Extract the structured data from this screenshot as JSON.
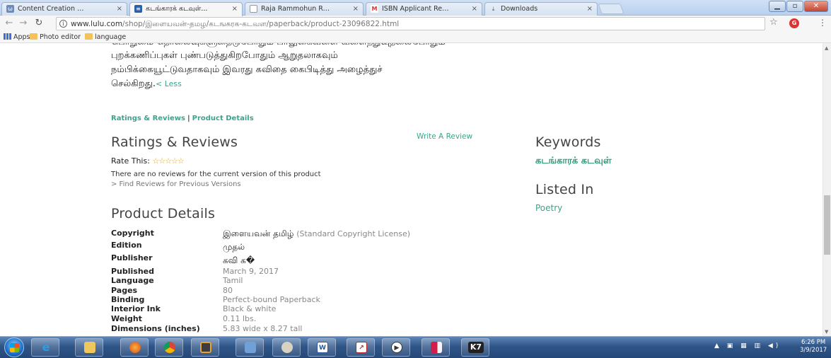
{
  "browser": {
    "tabs": [
      {
        "title": "Content Creation Wizard",
        "active": false
      },
      {
        "title": "கடங்காரக் கடவுள்...",
        "active": true
      },
      {
        "title": "Raja Rammohun Roy Na",
        "active": false
      },
      {
        "title": "ISBN Applicant Registrat",
        "active": false
      },
      {
        "title": "Downloads",
        "active": false
      }
    ],
    "close_glyph": "×",
    "url_host": "www.lulu.com",
    "url_path": "/shop/இளையவன்-தமழ/கடஙகரக-கடவள/paperback/product-23096822.html",
    "bookmarks": [
      "Apps",
      "Photo editor",
      "language"
    ]
  },
  "page": {
    "description_cut": "பொறுமை தொலைவுகளுதைடுபோதும் பாலுகைவளை வளைந்துவுதலைபோதும்",
    "description_lines": [
      "புறக்கணிப்புகள் புண்படுத்துகிறபோதும் ஆறுதலாகவும்",
      "நம்பிக்கையூட்டுவதாகவும் இவரது கவிதை கைபிடித்து அழைத்துச்",
      "செல்கிறது."
    ],
    "less_link": "< Less",
    "tab_links": [
      "Ratings & Reviews",
      "Product Details"
    ],
    "tab_sep": "|",
    "ratings": {
      "heading": "Ratings & Reviews",
      "write_review": "Write A Review",
      "rate_this": "Rate This:",
      "stars": "☆☆☆☆☆",
      "no_reviews": "There are no reviews for the current version of this product",
      "find_previous": "> Find Reviews for Previous Versions"
    },
    "keywords": {
      "heading": "Keywords",
      "value": "கடங்காரக் கடவுள்"
    },
    "listed_in": {
      "heading": "Listed In",
      "value": "Poetry"
    },
    "product_details": {
      "heading": "Product Details",
      "rows": [
        {
          "label": "Copyright",
          "value": "இளையவன் தமிழ்",
          "extra": "(Standard Copyright License)"
        },
        {
          "label": "Edition",
          "value": "முதல்"
        },
        {
          "label": "Publisher",
          "value": "கவி க�"
        },
        {
          "label": "Published",
          "value": "March 9, 2017"
        },
        {
          "label": "Language",
          "value": "Tamil"
        },
        {
          "label": "Pages",
          "value": "80"
        },
        {
          "label": "Binding",
          "value": "Perfect-bound Paperback"
        },
        {
          "label": "Interior Ink",
          "value": "Black & white"
        },
        {
          "label": "Weight",
          "value": "0.11 lbs."
        },
        {
          "label": "Dimensions (inches)",
          "value": "5.83 wide x 8.27 tall"
        }
      ]
    }
  },
  "taskbar": {
    "apps": [
      "internet-explorer",
      "file-explorer",
      "firefox",
      "chrome",
      "media-player",
      "control-panel",
      "paint",
      "word",
      "excel",
      "powerpoint-viewer",
      "presentation",
      "k7"
    ],
    "k7_label": "K7",
    "time": "6:26 PM",
    "date": "3/9/2017"
  },
  "colors": {
    "link_green": "#3aa58a",
    "keyword_green": "#2a9a7a",
    "star_gold": "#e3a61b"
  }
}
